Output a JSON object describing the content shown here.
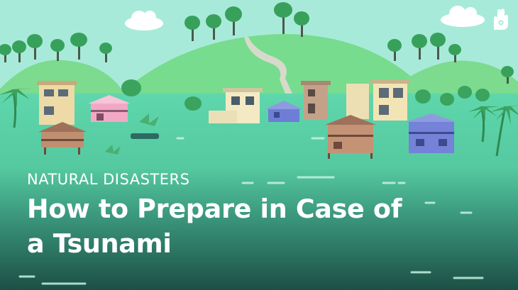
{
  "thumbnail": {
    "category": "NATURAL DISASTERS",
    "title_line1": "How to Prepare in Case of",
    "title_line2": "a Tsunami",
    "logo_icon": "raised-hand-icon",
    "colors": {
      "sky": "#a8ead9",
      "hill": "#77dc8e",
      "water": "#5fd6ac",
      "water_dark": "#1f5a4e",
      "text": "#ffffff"
    }
  }
}
